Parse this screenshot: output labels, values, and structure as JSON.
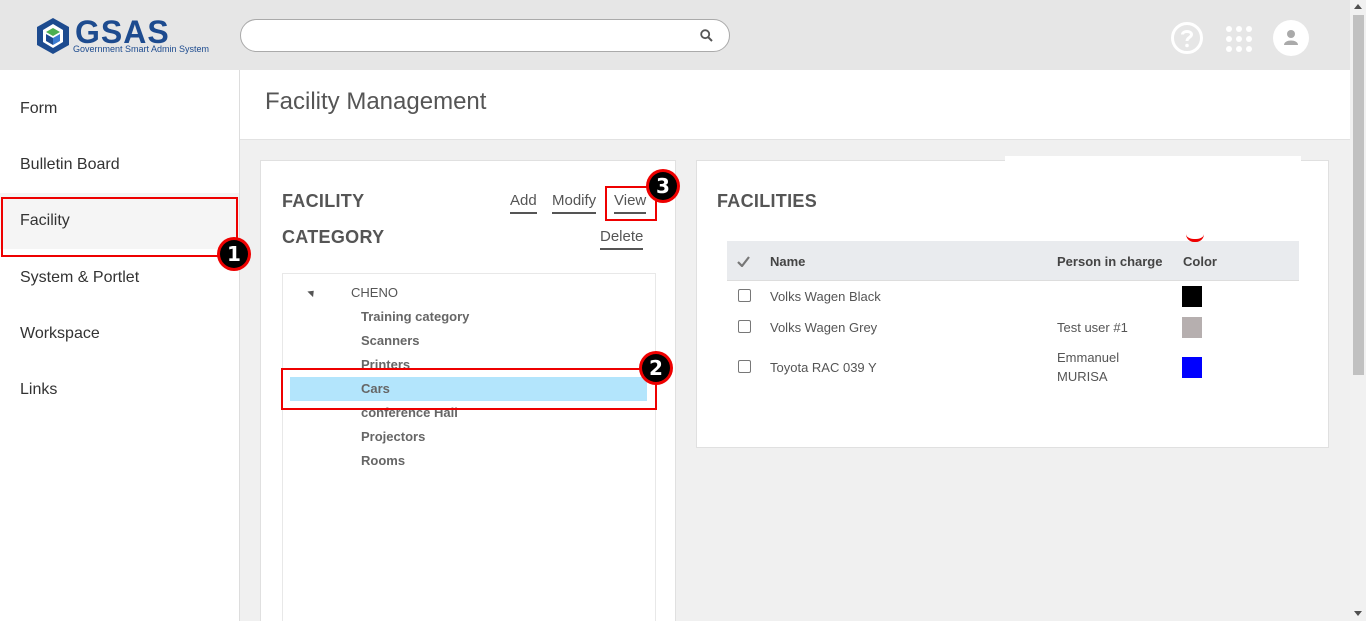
{
  "header": {
    "logo_text": "GSAS",
    "logo_subtitle": "Government Smart Admin System",
    "search_placeholder": ""
  },
  "sidebar": {
    "items": [
      {
        "label": "Form"
      },
      {
        "label": "Bulletin Board"
      },
      {
        "label": "Facility"
      },
      {
        "label": "System & Portlet"
      },
      {
        "label": "Workspace"
      },
      {
        "label": "Links"
      }
    ]
  },
  "page": {
    "title": "Facility Management"
  },
  "category_panel": {
    "title_line1": "FACILITY",
    "title_line2": "CATEGORY",
    "add_label": "Add",
    "modify_label": "Modify",
    "view_label": "View",
    "delete_label": "Delete",
    "tree": {
      "root": "CHENO",
      "children": [
        "Training category",
        "Scanners",
        "Printers",
        "Cars",
        "conference Hall",
        "Projectors",
        "Rooms"
      ],
      "selected": "Cars"
    }
  },
  "facilities_panel": {
    "title": "FACILITIES",
    "columns": [
      "Name",
      "Person in charge",
      "Color"
    ],
    "rows": [
      {
        "name": "Volks Wagen Black",
        "person_line1": "",
        "person_line2": "",
        "color": "#000000"
      },
      {
        "name": "Volks Wagen Grey",
        "person_line1": "Test user #1",
        "person_line2": "",
        "color": "#b6afaf"
      },
      {
        "name": "Toyota RAC 039 Y",
        "person_line1": "Emmanuel",
        "person_line2": "MURISA",
        "color": "#0000ff"
      }
    ]
  },
  "annotations": [
    "1",
    "2",
    "3"
  ]
}
